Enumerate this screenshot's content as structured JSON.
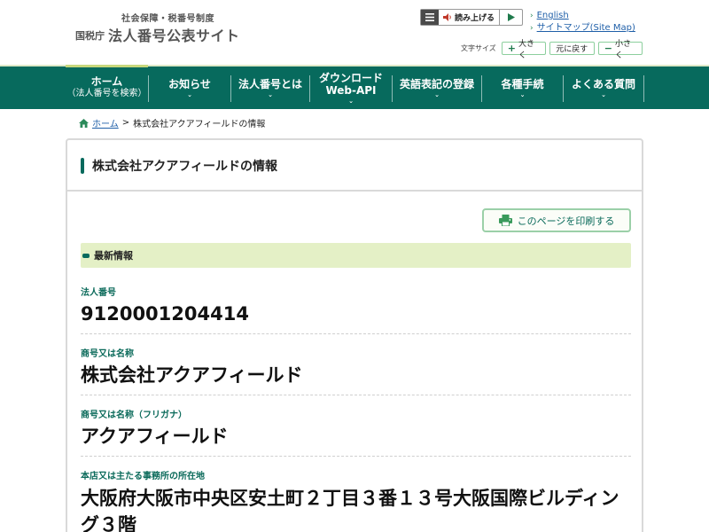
{
  "header": {
    "subtitle": "社会保障・税番号制度",
    "agency": "国税庁",
    "title": "法人番号公表サイト",
    "tts_label": "読み上げる",
    "links": [
      {
        "label": "English"
      },
      {
        "label": "サイトマップ(Site Map)"
      }
    ],
    "font_size_label": "文字サイズ",
    "font_buttons": {
      "larger": "大きく",
      "reset": "元に戻す",
      "smaller": "小さく"
    }
  },
  "nav": {
    "home_line1": "ホーム",
    "home_line2": "（法人番号を検索）",
    "news": "お知らせ",
    "about": "法人番号とは",
    "download_line1": "ダウンロード",
    "download_line2": "Web-API",
    "english": "英語表記の登録",
    "procedures": "各種手続",
    "faq": "よくある質問"
  },
  "breadcrumb": {
    "home": "ホーム",
    "separator": ">",
    "current": "株式会社アクアフィールドの情報"
  },
  "panel": {
    "title": "株式会社アクアフィールドの情報",
    "print_label": "このページを印刷する",
    "latest_label": "最新情報",
    "fields": [
      {
        "label": "法人番号",
        "value": "9120001204414"
      },
      {
        "label": "商号又は名称",
        "value": "株式会社アクアフィールド"
      },
      {
        "label": "商号又は名称（フリガナ）",
        "value": "アクアフィールド"
      },
      {
        "label": "本店又は主たる事務所の所在地",
        "value": "大阪府大阪市中央区安土町２丁目３番１３号大阪国際ビルディング３階"
      }
    ]
  },
  "colors": {
    "brand_green": "#076a5d",
    "accent_light": "#e4f0c6",
    "link_blue": "#1f5fa8"
  }
}
